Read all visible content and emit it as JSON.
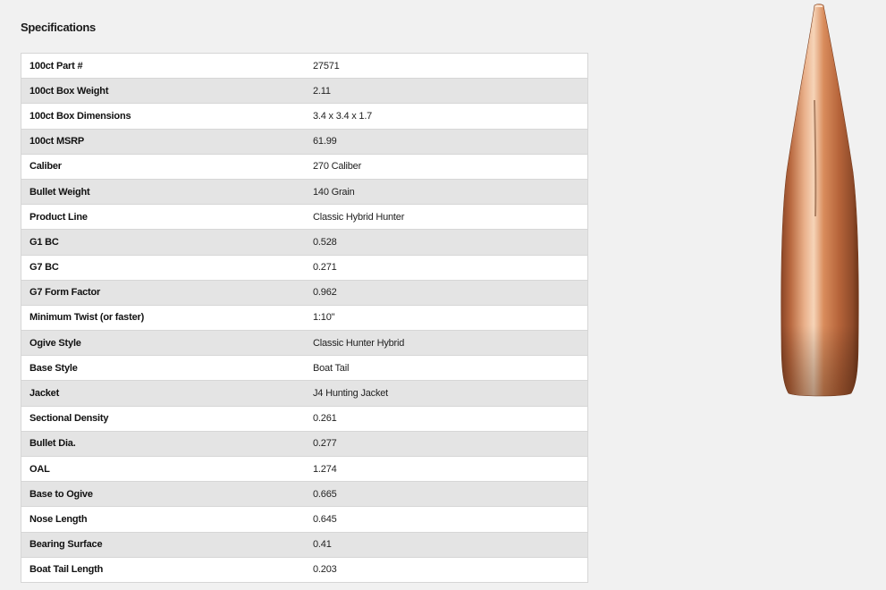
{
  "heading": "Specifications",
  "specs": [
    {
      "label": "100ct Part #",
      "value": "27571"
    },
    {
      "label": "100ct Box Weight",
      "value": "2.11"
    },
    {
      "label": "100ct Box Dimensions",
      "value": "3.4 x 3.4 x 1.7"
    },
    {
      "label": "100ct MSRP",
      "value": "61.99"
    },
    {
      "label": "Caliber",
      "value": "270 Caliber"
    },
    {
      "label": "Bullet Weight",
      "value": "140 Grain"
    },
    {
      "label": "Product Line",
      "value": "Classic Hybrid Hunter"
    },
    {
      "label": "G1 BC",
      "value": "0.528"
    },
    {
      "label": "G7 BC",
      "value": "0.271"
    },
    {
      "label": "G7 Form Factor",
      "value": "0.962"
    },
    {
      "label": "Minimum Twist (or faster)",
      "value": "1:10\""
    },
    {
      "label": "Ogive Style",
      "value": "Classic Hunter Hybrid"
    },
    {
      "label": "Base Style",
      "value": "Boat Tail"
    },
    {
      "label": "Jacket",
      "value": "J4 Hunting Jacket"
    },
    {
      "label": "Sectional Density",
      "value": "0.261"
    },
    {
      "label": "Bullet Dia.",
      "value": "0.277"
    },
    {
      "label": "OAL",
      "value": "1.274"
    },
    {
      "label": "Base to Ogive",
      "value": "0.665"
    },
    {
      "label": "Nose Length",
      "value": "0.645"
    },
    {
      "label": "Bearing Surface",
      "value": "0.41"
    },
    {
      "label": "Boat Tail Length",
      "value": "0.203"
    }
  ],
  "colors": {
    "page_background": "#f1f1f1",
    "row_alt": "#e4e4e4",
    "row": "#ffffff",
    "bullet_copper": "#c8794a"
  }
}
